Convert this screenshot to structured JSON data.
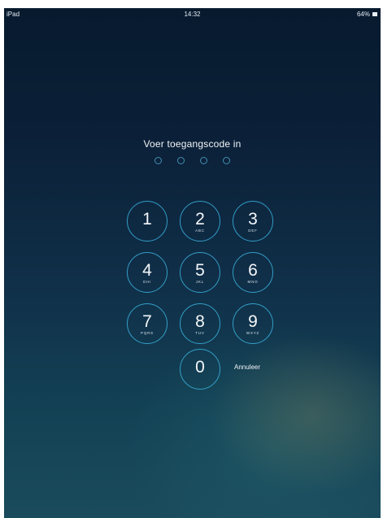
{
  "status_bar": {
    "device": "iPad",
    "time": "14:32",
    "battery": "64%"
  },
  "lock": {
    "prompt": "Voer toegangscode in",
    "passcode_length": 4,
    "cancel_label": "Annuleer"
  },
  "keypad": [
    {
      "digit": "1",
      "letters": ""
    },
    {
      "digit": "2",
      "letters": "ABC"
    },
    {
      "digit": "3",
      "letters": "DEF"
    },
    {
      "digit": "4",
      "letters": "GHI"
    },
    {
      "digit": "5",
      "letters": "JKL"
    },
    {
      "digit": "6",
      "letters": "MNO"
    },
    {
      "digit": "7",
      "letters": "PQRS"
    },
    {
      "digit": "8",
      "letters": "TUV"
    },
    {
      "digit": "9",
      "letters": "WXYZ"
    },
    {
      "digit": "0",
      "letters": ""
    }
  ]
}
